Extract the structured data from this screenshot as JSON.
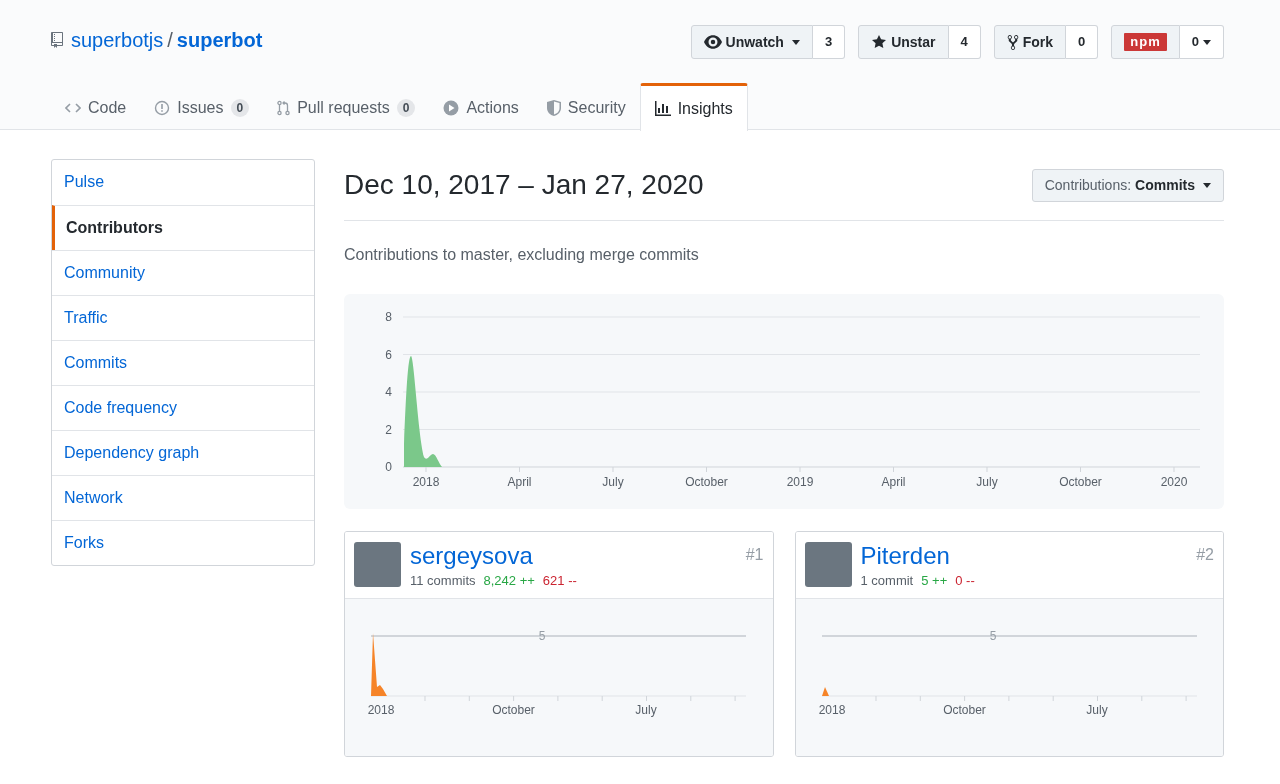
{
  "repo": {
    "owner": "superbotjs",
    "separator": "/",
    "name": "superbot"
  },
  "actions": [
    {
      "kind": "watch",
      "label": "Unwatch",
      "dropdown": true,
      "count": "3"
    },
    {
      "kind": "star",
      "label": "Unstar",
      "dropdown": false,
      "count": "4"
    },
    {
      "kind": "fork",
      "label": "Fork",
      "dropdown": false,
      "count": "0"
    },
    {
      "kind": "npm",
      "label": "npm",
      "dropdown": true,
      "count": "0"
    }
  ],
  "tabs": [
    {
      "kind": "code",
      "label": "Code",
      "selected": false
    },
    {
      "kind": "issues",
      "label": "Issues",
      "count": "0",
      "selected": false
    },
    {
      "kind": "pulls",
      "label": "Pull requests",
      "count": "0",
      "selected": false
    },
    {
      "kind": "actions",
      "label": "Actions",
      "selected": false
    },
    {
      "kind": "security",
      "label": "Security",
      "selected": false
    },
    {
      "kind": "insights",
      "label": "Insights",
      "selected": true
    }
  ],
  "sidebar": {
    "items": [
      {
        "label": "Pulse",
        "selected": false
      },
      {
        "label": "Contributors",
        "selected": true
      },
      {
        "label": "Community",
        "selected": false
      },
      {
        "label": "Traffic",
        "selected": false
      },
      {
        "label": "Commits",
        "selected": false
      },
      {
        "label": "Code frequency",
        "selected": false
      },
      {
        "label": "Dependency graph",
        "selected": false
      },
      {
        "label": "Network",
        "selected": false
      },
      {
        "label": "Forks",
        "selected": false
      }
    ]
  },
  "heading": "Dec 10, 2017 – Jan 27, 2020",
  "contributions_menu": {
    "label": "Contributions:",
    "value": "Commits"
  },
  "subtitle": "Contributions to master, excluding merge commits",
  "chart": {
    "y_labels": [
      "8",
      "6",
      "4",
      "2",
      "0"
    ],
    "x_labels": [
      "2018",
      "April",
      "July",
      "October",
      "2019",
      "April",
      "July",
      "October",
      "2020"
    ]
  },
  "contributors": [
    {
      "name": "sergeysova",
      "rank": "#1",
      "commits": "11 commits",
      "additions": "8,242 ++",
      "deletions": "621 --",
      "chart": {
        "y_label": "5",
        "x_labels": [
          "2018",
          "October",
          "July"
        ]
      }
    },
    {
      "name": "Piterden",
      "rank": "#2",
      "commits": "1 commit",
      "additions": "5 ++",
      "deletions": "0 --",
      "chart": {
        "y_label": "5",
        "x_labels": [
          "2018",
          "October",
          "July"
        ]
      }
    }
  ]
}
